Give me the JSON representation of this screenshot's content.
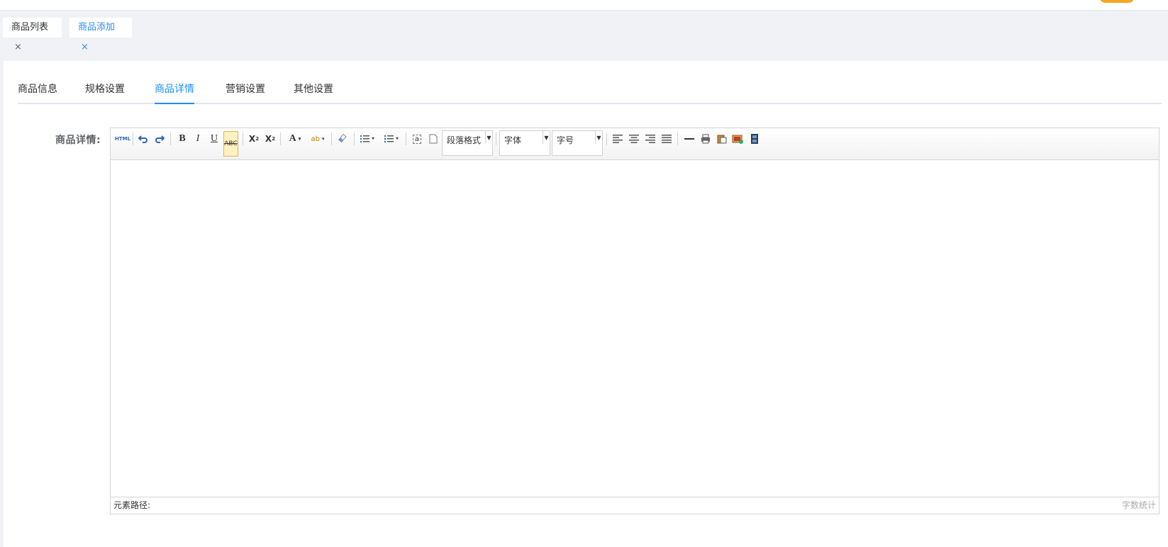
{
  "tags": [
    {
      "label": "商品列表",
      "close": "×"
    },
    {
      "label": "商品添加",
      "close": "×"
    }
  ],
  "tabs": [
    "商品信息",
    "规格设置",
    "商品详情",
    "营销设置",
    "其他设置"
  ],
  "active_tab": "商品详情",
  "form": {
    "detail_label": "商品详情:"
  },
  "editor": {
    "html_label": "HTML",
    "paragraph_format": "段落格式",
    "font_family": "字体",
    "font_size": "字号",
    "element_path_label": "元素路径:",
    "word_count_label": "字数统计"
  },
  "colors": {
    "accent": "#1890ff",
    "tag_active": "#2d8cf0",
    "badge": "#f5a623"
  }
}
